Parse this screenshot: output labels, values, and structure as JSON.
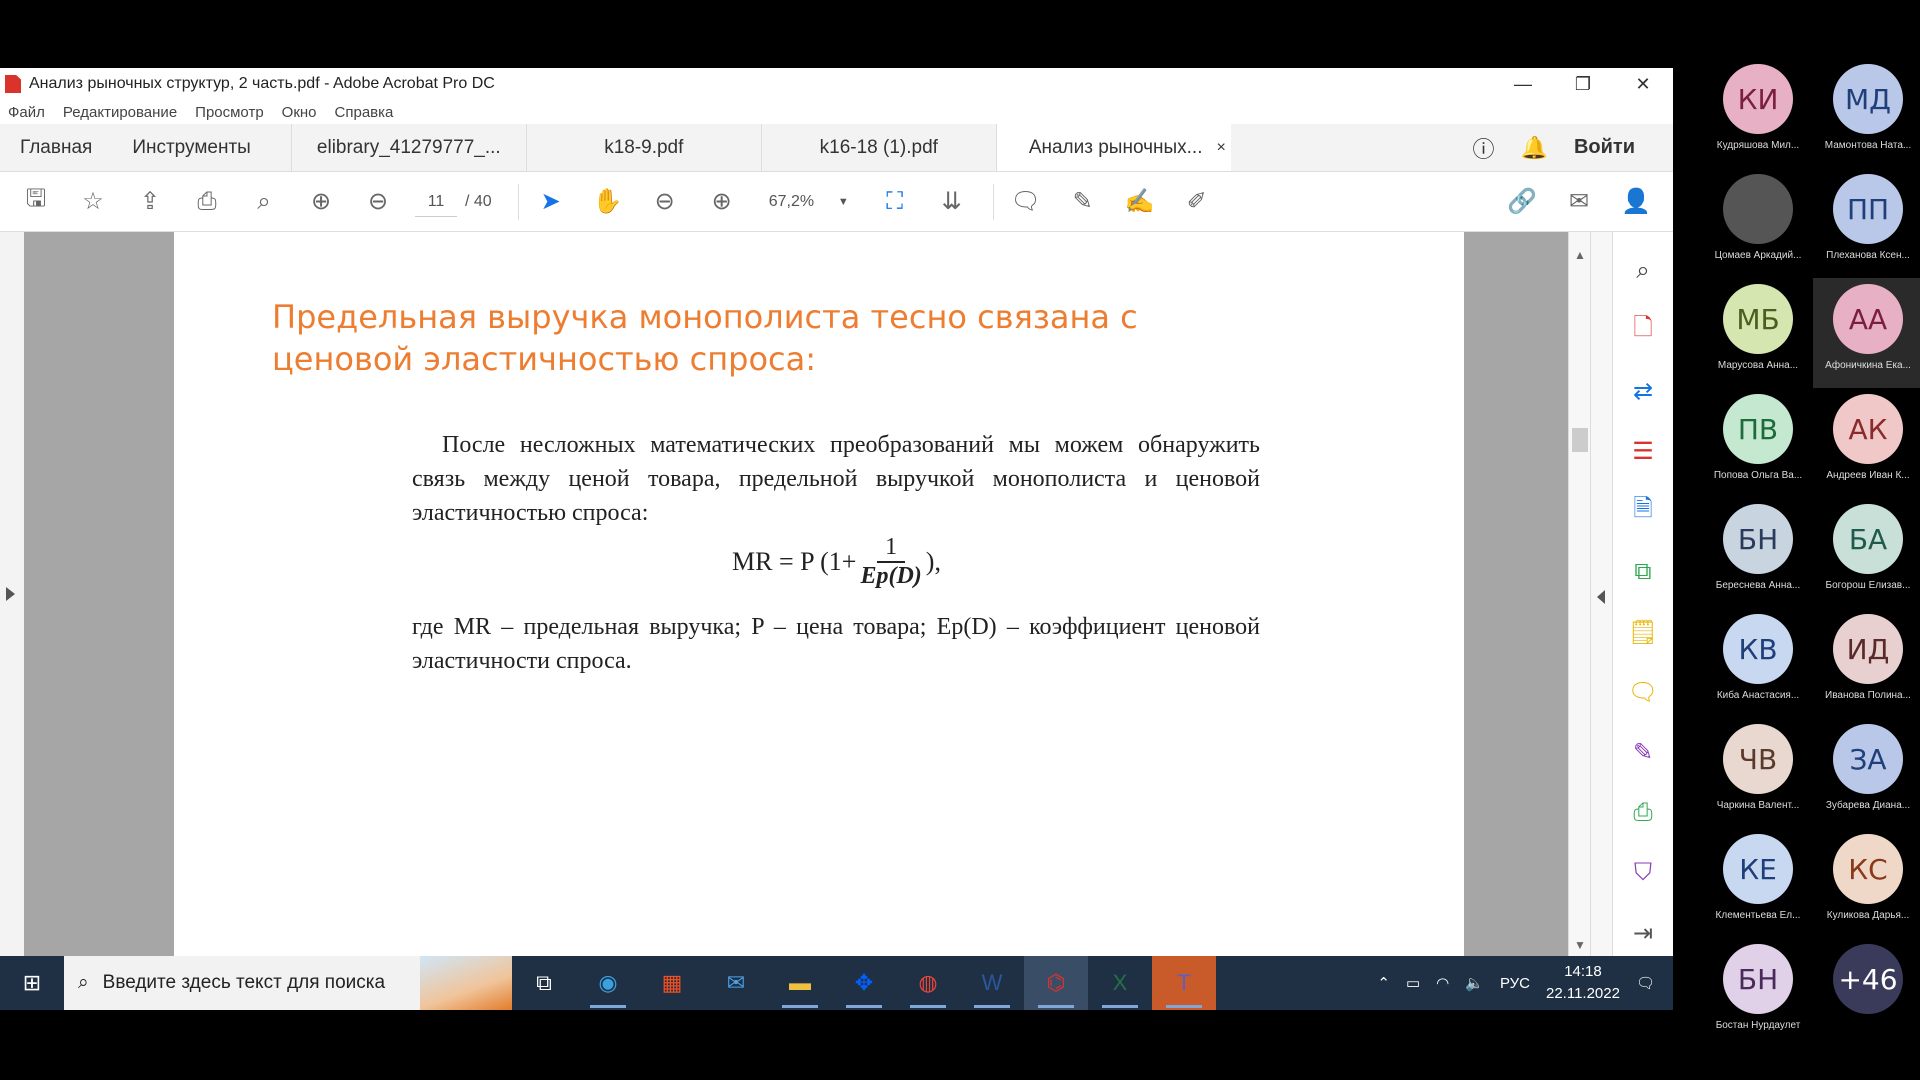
{
  "window": {
    "title": "Анализ рыночных структур, 2 часть.pdf - Adobe Acrobat Pro DC",
    "controls": {
      "minimize": "—",
      "restore": "❐",
      "close": "✕"
    }
  },
  "menu": [
    "Файл",
    "Редактирование",
    "Просмотр",
    "Окно",
    "Справка"
  ],
  "tabs": {
    "home": "Главная",
    "tools": "Инструменты",
    "docs": [
      "elibrary_41279777_...",
      "k18-9.pdf",
      "k16-18 (1).pdf",
      "Анализ рыночных..."
    ],
    "close": "×",
    "signin": "Войти"
  },
  "toolbar": {
    "page_current": "11",
    "page_separator": "/",
    "page_total": "40",
    "zoom": "67,2%"
  },
  "document": {
    "heading": "Предельная выручка монополиста тесно связана с ценовой эластичностью спроса:",
    "paragraph": "После несложных математических преобразований мы можем обнаружить связь между ценой товара, предельной выручкой монополиста и ценовой эластичностью спроса:",
    "formula": {
      "lhs": "MR = P (1+",
      "numerator": "1",
      "denominator": "Ep(D)",
      "rhs": "),"
    },
    "where": "где MR – предельная выручка; P – цена товара; Eр(D) – коэффициент ценовой эластичности спроса."
  },
  "taskbar": {
    "search_placeholder": "Введите здесь текст для поиска",
    "lang": "РУС",
    "time": "14:18",
    "date": "22.11.2022"
  },
  "participants": [
    {
      "initials": "КИ",
      "name": "Кудряшова Мил...",
      "color": "#e8b0c4",
      "text": "#7a1f3f"
    },
    {
      "initials": "МД",
      "name": "Мамонтова Ната...",
      "color": "#b9c8e8",
      "text": "#1f3f7a"
    },
    {
      "initials": "",
      "name": "Цомаев Аркадий...",
      "color": "#555555",
      "text": "#ffffff"
    },
    {
      "initials": "ПП",
      "name": "Плеханова Ксен...",
      "color": "#b9c8e8",
      "text": "#1f3f7a"
    },
    {
      "initials": "МБ",
      "name": "Марусова Анна...",
      "color": "#d6e6b0",
      "text": "#4a5f1f"
    },
    {
      "initials": "АА",
      "name": "Афоничкина Ека...",
      "color": "#e8b0c4",
      "text": "#7a1f3f"
    },
    {
      "initials": "ПВ",
      "name": "Попова Ольга Ва...",
      "color": "#c4e8d0",
      "text": "#1f6a3a"
    },
    {
      "initials": "АК",
      "name": "Андреев Иван К...",
      "color": "#f0c8c8",
      "text": "#8a2a2a"
    },
    {
      "initials": "БН",
      "name": "Береснева Анна...",
      "color": "#c8d4e0",
      "text": "#2a3a5a"
    },
    {
      "initials": "БА",
      "name": "Богорош Елизав...",
      "color": "#c8e0d8",
      "text": "#1f5a4a"
    },
    {
      "initials": "КВ",
      "name": "Киба Анастасия...",
      "color": "#c8d8f0",
      "text": "#1f3f7a"
    },
    {
      "initials": "ИД",
      "name": "Иванова Полина...",
      "color": "#e8d0d0",
      "text": "#5a2a2a"
    },
    {
      "initials": "ЧВ",
      "name": "Чаркина Валент...",
      "color": "#e8d8d0",
      "text": "#5a3a2a"
    },
    {
      "initials": "ЗА",
      "name": "Зубарева Диана...",
      "color": "#b9c8e8",
      "text": "#1f3f7a"
    },
    {
      "initials": "КЕ",
      "name": "Клементьева Ел...",
      "color": "#c8d8f0",
      "text": "#1f3f7a"
    },
    {
      "initials": "КС",
      "name": "Куликова Дарья...",
      "color": "#f0d8c8",
      "text": "#8a3a1a"
    },
    {
      "initials": "БН",
      "name": "Бостан Нурдаулет",
      "color": "#e0d0e8",
      "text": "#4a2a5a"
    },
    {
      "initials": "+46",
      "name": "",
      "color": "#3a3a5a",
      "text": "#ffffff"
    }
  ]
}
